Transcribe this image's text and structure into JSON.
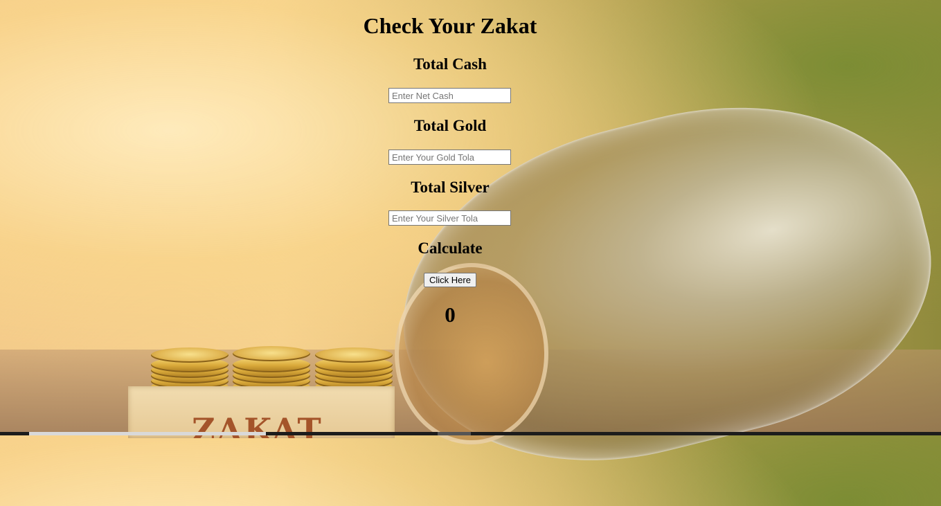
{
  "background": {
    "block_text": "ZAKAT"
  },
  "form": {
    "title": "Check Your Zakat",
    "cash": {
      "label": "Total Cash",
      "placeholder": "Enter Net Cash",
      "value": ""
    },
    "gold": {
      "label": "Total Gold",
      "placeholder": "Enter Your Gold Tola",
      "value": ""
    },
    "silver": {
      "label": "Total Silver",
      "placeholder": "Enter Your Silver Tola",
      "value": ""
    },
    "calculate": {
      "label": "Calculate",
      "button_label": "Click Here"
    },
    "result": "0"
  }
}
